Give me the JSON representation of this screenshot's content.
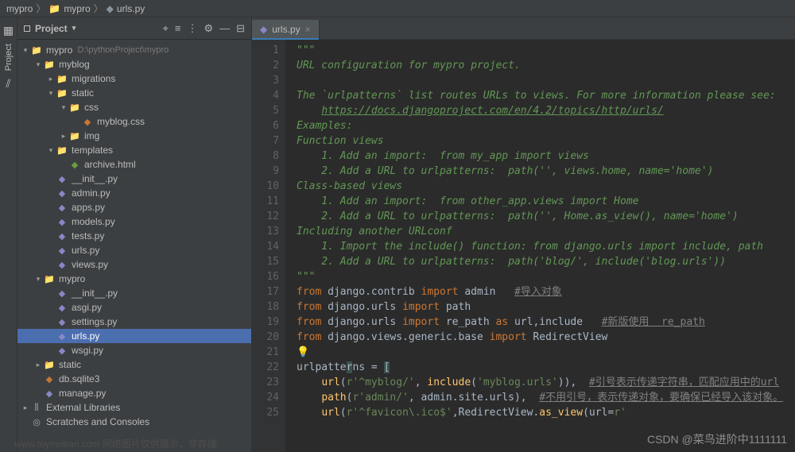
{
  "breadcrumb": {
    "root": "mypro",
    "folder": "mypro",
    "file": "urls.py"
  },
  "sidebar": {
    "project_tab": "Project",
    "structure_icon": "⫽"
  },
  "project_panel": {
    "title": "Project",
    "toolbar": {
      "focus": "⌖",
      "select": "≡",
      "sep": "⋮",
      "settings": "⚙",
      "collapse": "—",
      "hide": "⊟"
    },
    "tree": [
      {
        "depth": 0,
        "arrow": "▾",
        "icon": "📁",
        "iconClass": "folder-icon",
        "label": "mypro",
        "path": "D:\\pythonProject\\mypro"
      },
      {
        "depth": 1,
        "arrow": "▾",
        "icon": "📁",
        "iconClass": "folder-icon",
        "label": "myblog"
      },
      {
        "depth": 2,
        "arrow": "▸",
        "icon": "📁",
        "iconClass": "folder-icon",
        "label": "migrations"
      },
      {
        "depth": 2,
        "arrow": "▾",
        "icon": "📁",
        "iconClass": "folder-icon",
        "label": "static"
      },
      {
        "depth": 3,
        "arrow": "▾",
        "icon": "📁",
        "iconClass": "folder-icon",
        "label": "css"
      },
      {
        "depth": 4,
        "arrow": "",
        "icon": "◆",
        "iconClass": "css-icon",
        "label": "myblog.css"
      },
      {
        "depth": 3,
        "arrow": "▸",
        "icon": "📁",
        "iconClass": "folder-icon",
        "label": "img"
      },
      {
        "depth": 2,
        "arrow": "▾",
        "icon": "📁",
        "iconClass": "folder-icon",
        "label": "templates"
      },
      {
        "depth": 3,
        "arrow": "",
        "icon": "◆",
        "iconClass": "html-icon",
        "label": "archive.html"
      },
      {
        "depth": 2,
        "arrow": "",
        "icon": "◆",
        "iconClass": "py-icon",
        "label": "__init__.py"
      },
      {
        "depth": 2,
        "arrow": "",
        "icon": "◆",
        "iconClass": "py-icon",
        "label": "admin.py"
      },
      {
        "depth": 2,
        "arrow": "",
        "icon": "◆",
        "iconClass": "py-icon",
        "label": "apps.py"
      },
      {
        "depth": 2,
        "arrow": "",
        "icon": "◆",
        "iconClass": "py-icon",
        "label": "models.py"
      },
      {
        "depth": 2,
        "arrow": "",
        "icon": "◆",
        "iconClass": "py-icon",
        "label": "tests.py"
      },
      {
        "depth": 2,
        "arrow": "",
        "icon": "◆",
        "iconClass": "py-icon",
        "label": "urls.py"
      },
      {
        "depth": 2,
        "arrow": "",
        "icon": "◆",
        "iconClass": "py-icon",
        "label": "views.py"
      },
      {
        "depth": 1,
        "arrow": "▾",
        "icon": "📁",
        "iconClass": "folder-icon",
        "label": "mypro"
      },
      {
        "depth": 2,
        "arrow": "",
        "icon": "◆",
        "iconClass": "py-icon",
        "label": "__init__.py"
      },
      {
        "depth": 2,
        "arrow": "",
        "icon": "◆",
        "iconClass": "py-icon",
        "label": "asgi.py"
      },
      {
        "depth": 2,
        "arrow": "",
        "icon": "◆",
        "iconClass": "py-icon",
        "label": "settings.py"
      },
      {
        "depth": 2,
        "arrow": "",
        "icon": "◆",
        "iconClass": "py-icon",
        "label": "urls.py",
        "selected": true
      },
      {
        "depth": 2,
        "arrow": "",
        "icon": "◆",
        "iconClass": "py-icon",
        "label": "wsgi.py"
      },
      {
        "depth": 1,
        "arrow": "▸",
        "icon": "📁",
        "iconClass": "folder-icon",
        "label": "static"
      },
      {
        "depth": 1,
        "arrow": "",
        "icon": "◆",
        "iconClass": "db-icon",
        "label": "db.sqlite3"
      },
      {
        "depth": 1,
        "arrow": "",
        "icon": "◆",
        "iconClass": "py-icon",
        "label": "manage.py"
      },
      {
        "depth": 0,
        "arrow": "▸",
        "icon": "⫼",
        "iconClass": "lib-icon",
        "label": "External Libraries"
      },
      {
        "depth": 0,
        "arrow": "",
        "icon": "◎",
        "iconClass": "lib-icon",
        "label": "Scratches and Consoles"
      }
    ]
  },
  "editor": {
    "tab": {
      "icon": "◆",
      "label": "urls.py",
      "close": "×"
    },
    "bulb": "💡",
    "lines": [
      {
        "n": 1,
        "html": "<span class='c-docstring'>\"\"\"</span>"
      },
      {
        "n": 2,
        "html": "<span class='c-docstring'>URL configuration for mypro project.</span>"
      },
      {
        "n": 3,
        "html": ""
      },
      {
        "n": 4,
        "html": "<span class='c-docstring'>The `urlpatterns` list routes URLs to views. For more information please see:</span>"
      },
      {
        "n": 5,
        "html": "    <span class='c-docstring-link'>https://docs.djangoproject.com/en/4.2/topics/http/urls/</span>"
      },
      {
        "n": 6,
        "html": "<span class='c-docstring'>Examples:</span>"
      },
      {
        "n": 7,
        "html": "<span class='c-docstring'>Function views</span>"
      },
      {
        "n": 8,
        "html": "<span class='c-docstring'>    1. Add an import:  from my_app import views</span>"
      },
      {
        "n": 9,
        "html": "<span class='c-docstring'>    2. Add a URL to urlpatterns:  path('', views.home, name='home')</span>"
      },
      {
        "n": 10,
        "html": "<span class='c-docstring'>Class-based views</span>"
      },
      {
        "n": 11,
        "html": "<span class='c-docstring'>    1. Add an import:  from other_app.views import Home</span>"
      },
      {
        "n": 12,
        "html": "<span class='c-docstring'>    2. Add a URL to urlpatterns:  path('', Home.as_view(), name='home')</span>"
      },
      {
        "n": 13,
        "html": "<span class='c-docstring'>Including another URLconf</span>"
      },
      {
        "n": 14,
        "html": "<span class='c-docstring'>    1. Import the include() function: from django.urls import include, path</span>"
      },
      {
        "n": 15,
        "html": "<span class='c-docstring'>    2. Add a URL to urlpatterns:  path('blog/', include('blog.urls'))</span>"
      },
      {
        "n": 16,
        "html": "<span class='c-docstring'>\"\"\"</span>"
      },
      {
        "n": 17,
        "html": "<span class='c-keyword'>from</span> django.contrib <span class='c-keyword'>import</span> admin   <span class='c-comment-line'>#导入对象</span>"
      },
      {
        "n": 18,
        "html": "<span class='c-keyword'>from</span> django.urls <span class='c-keyword'>import</span> path"
      },
      {
        "n": 19,
        "html": "<span class='c-keyword'>from</span> django.urls <span class='c-keyword'>import</span> re_path <span class='c-keyword'>as</span> url<span class='c-op'>,</span>include   <span class='c-comment-line'>#新版使用  re_path</span>"
      },
      {
        "n": 20,
        "html": "<span class='c-keyword'>from</span> django.views.generic.base <span class='c-keyword'>import</span> RedirectView"
      },
      {
        "n": 21,
        "html": "<span class='bulb'>💡</span>"
      },
      {
        "n": 22,
        "html": "urlpatte<span class='hl-bracket'>r</span>ns = <span class='hl-bracket'>[</span>"
      },
      {
        "n": 23,
        "html": "    <span class='c-func'>url</span>(<span class='c-string'>r'^myblog/'</span><span class='c-op'>,</span> <span class='c-func'>include</span>(<span class='c-string'>'myblog.urls'</span>))<span class='c-op'>,</span>  <span class='c-comment-line'>#引号表示传递字符串，匹配应用中的url</span>"
      },
      {
        "n": 24,
        "html": "    <span class='c-func'>path</span>(<span class='c-string'>r'admin/'</span><span class='c-op'>,</span> admin.site.urls)<span class='c-op'>,</span>  <span class='c-comment-line'>#不用引号，表示传递对象，要确保已经导入该对象。</span>"
      },
      {
        "n": 25,
        "html": "    <span class='c-func'>url</span>(<span class='c-string'>r'^favicon\\.ico$'</span><span class='c-op'>,</span>RedirectView.<span class='c-func'>as_view</span>(<span class='c-ident'>url</span>=<span class='c-string'>r'</span>"
      }
    ]
  },
  "watermark": "CSDN @菜鸟进阶中1111111",
  "bg_watermark": "www.toymoban.com 网络图片仅供展示，非存储"
}
